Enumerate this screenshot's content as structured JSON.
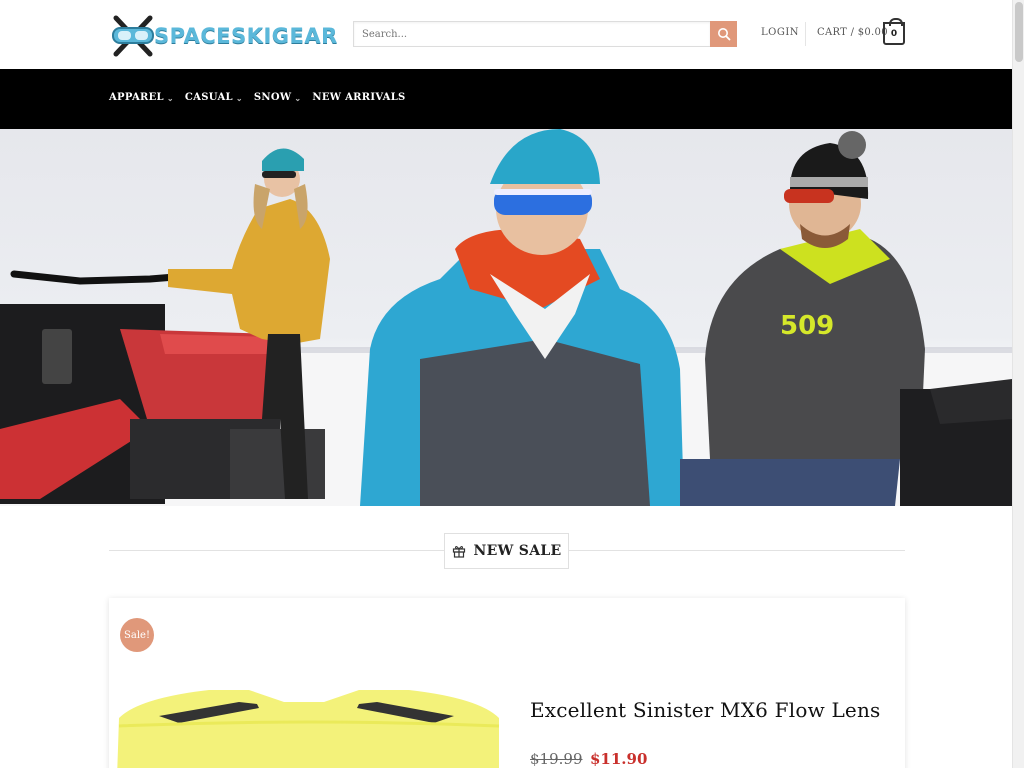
{
  "brand": {
    "name": "SPACESKIGEAR",
    "accent": "#5bb8da",
    "sale_color": "#e0987a",
    "price_color": "#c9302c"
  },
  "search": {
    "placeholder": "Search..."
  },
  "header": {
    "login_label": "LOGIN",
    "cart_label": "CART / $0.00",
    "cart_count": "0"
  },
  "nav": {
    "items": [
      {
        "label": "APPAREL",
        "has_dropdown": true
      },
      {
        "label": "CASUAL",
        "has_dropdown": true
      },
      {
        "label": "SNOW",
        "has_dropdown": true
      },
      {
        "label": "NEW ARRIVALS",
        "has_dropdown": false
      }
    ]
  },
  "hero": {
    "icon": "hero-banner-image",
    "chest_logo": "509"
  },
  "section": {
    "title": "NEW SALE",
    "icon": "gift-icon"
  },
  "product": {
    "badge": "Sale!",
    "title": "Excellent Sinister MX6 Flow Lens",
    "price_old": "$19.99",
    "price_new": "$11.90"
  }
}
